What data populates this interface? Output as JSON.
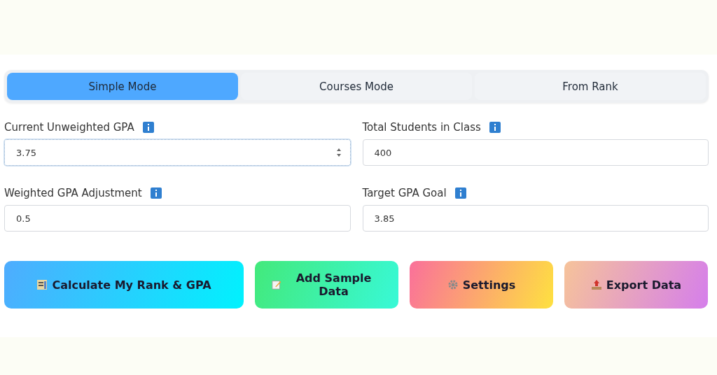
{
  "tabs": [
    {
      "label": "Simple Mode",
      "selected": true
    },
    {
      "label": "Courses Mode",
      "selected": false
    },
    {
      "label": "From Rank",
      "selected": false
    }
  ],
  "fields": [
    {
      "label": "Current Unweighted GPA",
      "value": "3.75",
      "focused": true
    },
    {
      "label": "Total Students in Class",
      "value": "400",
      "focused": false
    },
    {
      "label": "Weighted GPA Adjustment",
      "value": "0.5",
      "focused": false
    },
    {
      "label": "Target GPA Goal",
      "value": "3.85",
      "focused": false
    }
  ],
  "buttons": [
    {
      "label": "Calculate My Rank & GPA",
      "kind": "calculate"
    },
    {
      "label": "Add Sample Data",
      "kind": "sample"
    },
    {
      "label": "Settings",
      "kind": "settings"
    },
    {
      "label": "Export Data",
      "kind": "export"
    }
  ]
}
